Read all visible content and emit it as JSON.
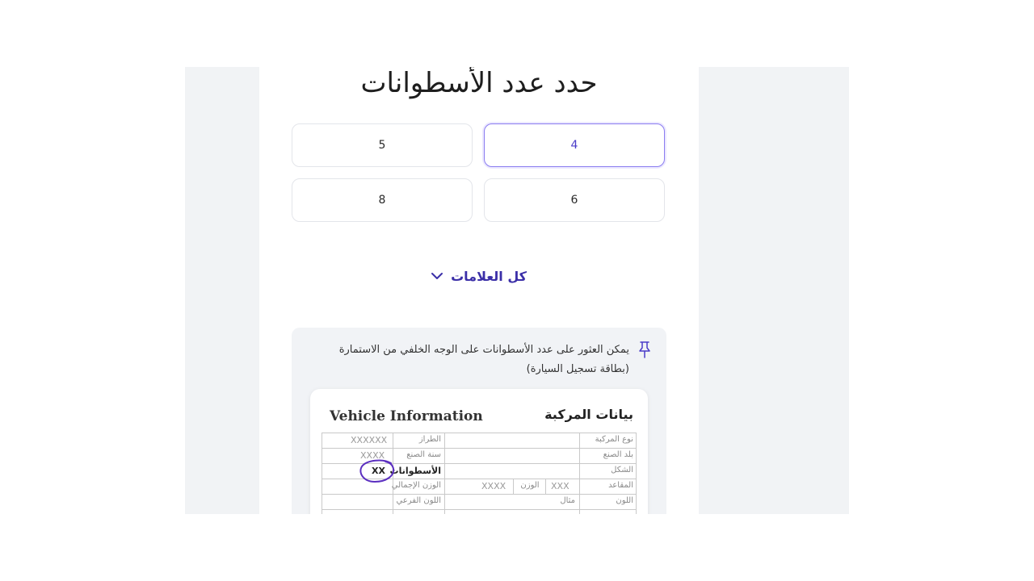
{
  "title": "حدد عدد الأسطوانات",
  "options": [
    {
      "label": "4",
      "selected": true
    },
    {
      "label": "5",
      "selected": false
    },
    {
      "label": "6",
      "selected": false
    },
    {
      "label": "8",
      "selected": false
    }
  ],
  "toggle": {
    "label": "كل العلامات",
    "icon": "chevron-down-icon"
  },
  "hint": {
    "icon": "pin-icon",
    "line1": "يمكن العثور على عدد الأسطوانات على الوجه الخلفي من الاستمارة",
    "line2": "(بطاقة تسجيل السيارة)"
  },
  "card": {
    "title_en": "Vehicle Information",
    "title_ar": "بيانات المركبة",
    "rows": [
      {
        "right_label": "نوع المركبة",
        "left_label": "الطراز",
        "left_value": "XXXXXX"
      },
      {
        "right_label": "بلد الصنع",
        "left_label": "سنة الصنع",
        "left_value": "XXXX"
      },
      {
        "right_label": "الشكل",
        "left_label": "الأسطوانات",
        "left_value": "XX"
      },
      {
        "right_label": "المقاعد",
        "mid_value": "XXX",
        "mid_label": "الوزن",
        "mid_value2": "XXXX",
        "left_label": "الوزن الإجمالي"
      },
      {
        "right_label": "اللون",
        "mid_text": "مثال",
        "left_label": "اللون الفرعي"
      }
    ]
  },
  "colors": {
    "accent": "#4a3cc8",
    "selected_border": "#8b7df0",
    "panel": "#f1f3f5",
    "circle": "#5b2fc0"
  }
}
